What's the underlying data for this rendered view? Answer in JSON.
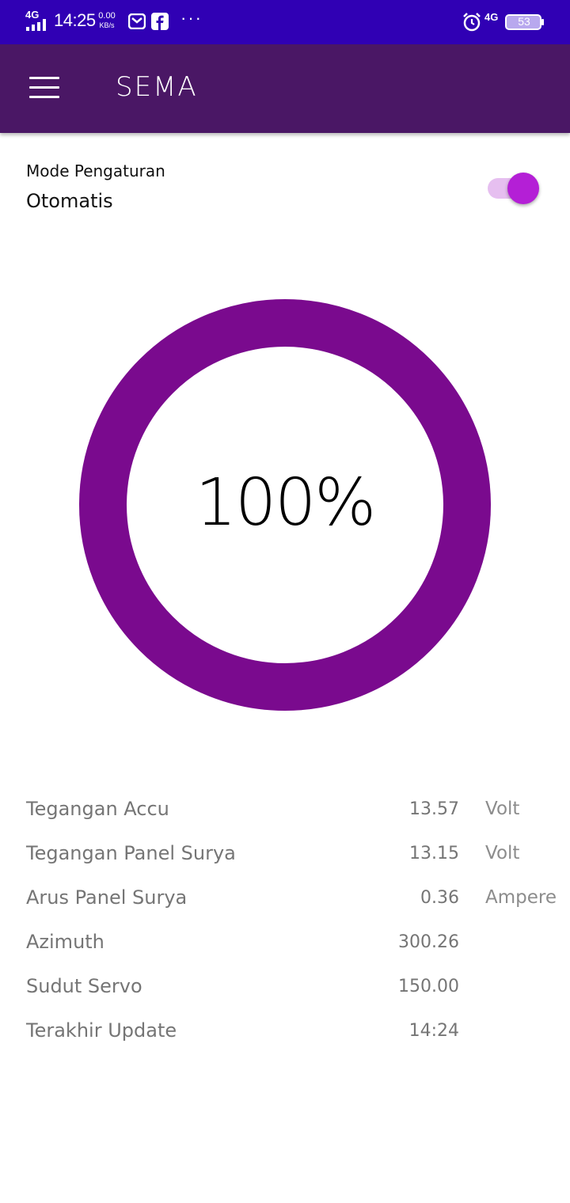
{
  "status_bar": {
    "network": "4G",
    "time": "14:25",
    "speed_value": "0.00",
    "speed_unit": "KB/s",
    "more": "···",
    "network_right": "4G",
    "battery": "53",
    "background": "#3000b4"
  },
  "app_bar": {
    "title": "SEMA",
    "background": "#4a1765",
    "menu_icon": "menu-icon"
  },
  "mode": {
    "label": "Mode Pengaturan",
    "value": "Otomatis",
    "toggle_on": true,
    "accent": "#b41fd6"
  },
  "gauge": {
    "value_text": "100%",
    "percent": 100,
    "color": "#7a0a8e"
  },
  "readings": [
    {
      "label": "Tegangan Accu",
      "value": "13.57",
      "unit": "Volt"
    },
    {
      "label": "Tegangan Panel Surya",
      "value": "13.15",
      "unit": "Volt"
    },
    {
      "label": "Arus Panel Surya",
      "value": "0.36",
      "unit": "Ampere"
    },
    {
      "label": "Azimuth",
      "value": "300.26",
      "unit": ""
    },
    {
      "label": "Sudut Servo",
      "value": "150.00",
      "unit": ""
    },
    {
      "label": "Terakhir Update",
      "value": "14:24",
      "unit": ""
    }
  ]
}
